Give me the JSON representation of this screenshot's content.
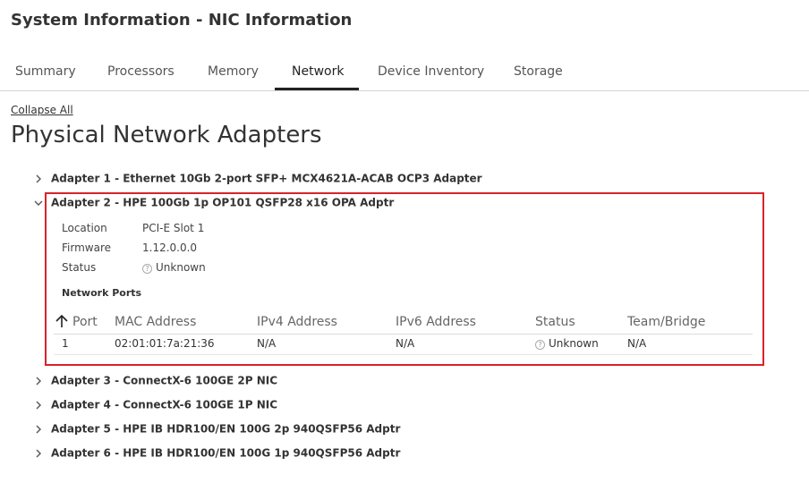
{
  "page": {
    "title": "System Information - NIC Information"
  },
  "tabs": [
    {
      "label": "Summary"
    },
    {
      "label": "Processors"
    },
    {
      "label": "Memory"
    },
    {
      "label": "Network",
      "active": true
    },
    {
      "label": "Device Inventory"
    },
    {
      "label": "Storage"
    }
  ],
  "collapse_all": "Collapse All",
  "section_title": "Physical Network Adapters",
  "adapters": [
    {
      "label": "Adapter 1 - Ethernet 10Gb 2-port SFP+ MCX4621A-ACAB OCP3 Adapter",
      "expanded": false
    },
    {
      "label": "Adapter 2 - HPE 100Gb 1p OP101 QSFP28 x16 OPA Adptr",
      "expanded": true
    },
    {
      "label": "Adapter 3 - ConnectX-6 100GE 2P NIC",
      "expanded": false
    },
    {
      "label": "Adapter 4 - ConnectX-6 100GE 1P NIC",
      "expanded": false
    },
    {
      "label": "Adapter 5 - HPE IB HDR100/EN 100G 2p 940QSFP56 Adptr",
      "expanded": false
    },
    {
      "label": "Adapter 6 - HPE IB HDR100/EN 100G 1p 940QSFP56 Adptr",
      "expanded": false
    }
  ],
  "details": {
    "location_label": "Location",
    "location_value": "PCI-E Slot 1",
    "firmware_label": "Firmware",
    "firmware_value": "1.12.0.0.0",
    "status_label": "Status",
    "status_value": "Unknown"
  },
  "ports": {
    "title": "Network Ports",
    "headers": [
      "Port",
      "MAC Address",
      "IPv4 Address",
      "IPv6 Address",
      "Status",
      "Team/Bridge"
    ],
    "rows": [
      [
        "1",
        "02:01:01:7a:21:36",
        "N/A",
        "N/A",
        "Unknown",
        "N/A"
      ]
    ]
  },
  "icons": {
    "chevron_collapsed": "chevron-right-icon",
    "chevron_expanded": "chevron-down-icon",
    "status_unknown": "help-circle-icon",
    "sort": "arrow-up-icon"
  },
  "colors": {
    "highlight_border": "#d9222a"
  }
}
